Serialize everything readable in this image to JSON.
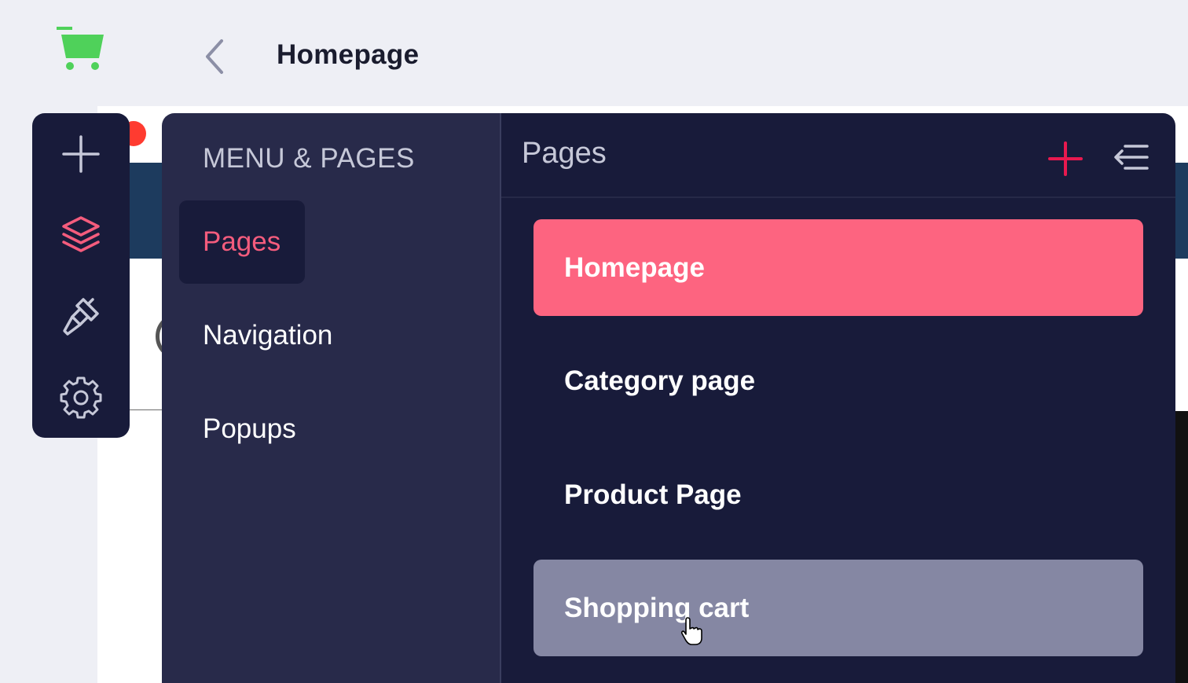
{
  "header": {
    "title": "Homepage",
    "logo_icon": "shopping-cart-icon",
    "back_icon": "chevron-left-icon"
  },
  "toolbar": {
    "items": [
      {
        "icon": "plus-icon",
        "active": false
      },
      {
        "icon": "layers-icon",
        "active": true
      },
      {
        "icon": "brush-icon",
        "active": false
      },
      {
        "icon": "gear-icon",
        "active": false
      }
    ]
  },
  "menu": {
    "heading": "MENU & PAGES",
    "items": [
      {
        "label": "Pages",
        "active": true
      },
      {
        "label": "Navigation",
        "active": false
      },
      {
        "label": "Popups",
        "active": false
      }
    ]
  },
  "pages": {
    "title": "Pages",
    "add_icon": "plus-icon",
    "collapse_icon": "collapse-menu-icon",
    "list": [
      {
        "label": "Homepage",
        "state": "selected"
      },
      {
        "label": "Category page",
        "state": "normal"
      },
      {
        "label": "Product Page",
        "state": "normal"
      },
      {
        "label": "Shopping cart",
        "state": "hover"
      }
    ]
  },
  "colors": {
    "accent": "#fd6480",
    "accent_icon": "#e8194f",
    "panel_dark": "#181b3a",
    "panel_mid": "#282a4a",
    "hover": "#8587a3",
    "logo_green": "#4fd15a"
  }
}
